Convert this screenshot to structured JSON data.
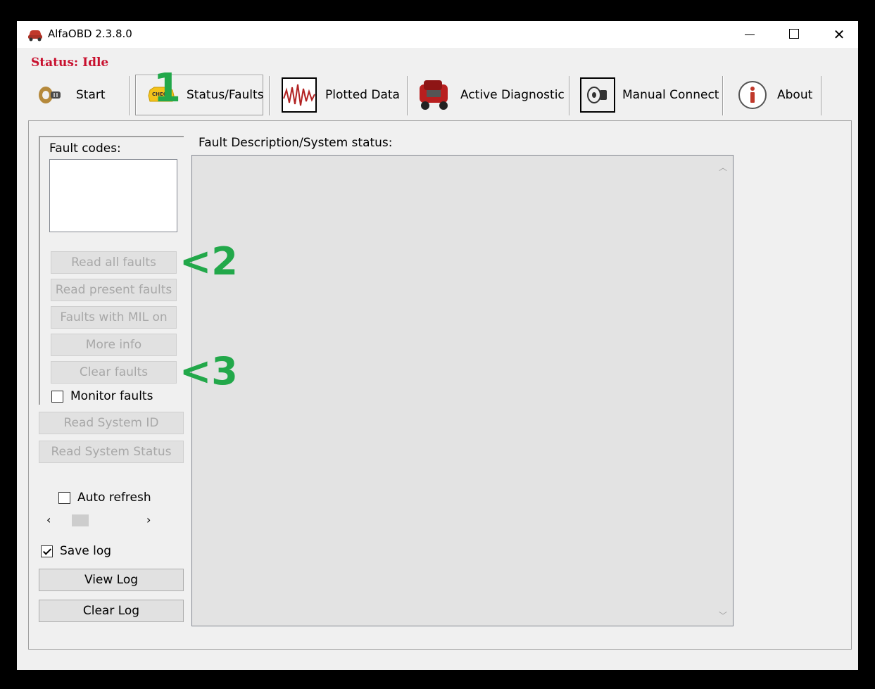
{
  "window": {
    "title": "AlfaOBD 2.3.8.0"
  },
  "status": {
    "text": "Status: Idle"
  },
  "toolbar": {
    "start": "Start",
    "status_faults": "Status/Faults",
    "check_badge": "CHECK",
    "plotted_data": "Plotted Data",
    "active_diagnostic": "Active Diagnostic",
    "manual_connect": "Manual Connect",
    "about": "About"
  },
  "faults": {
    "label": "Fault codes:",
    "read_all": "Read all faults",
    "read_present": "Read present faults",
    "mil_on": "Faults with MIL on",
    "more_info": "More info",
    "clear": "Clear faults",
    "monitor": "Monitor faults"
  },
  "system": {
    "read_id": "Read System ID",
    "read_status": "Read System Status",
    "auto_refresh": "Auto refresh",
    "save_log": "Save log",
    "view_log": "View Log",
    "clear_log": "Clear Log"
  },
  "description": {
    "label": "Fault Description/System status:"
  },
  "annotations": {
    "a1": "1",
    "a2": "<2",
    "a3": "<3"
  },
  "colors": {
    "status_red": "#c8102e",
    "annotation_green": "#22a84a"
  }
}
